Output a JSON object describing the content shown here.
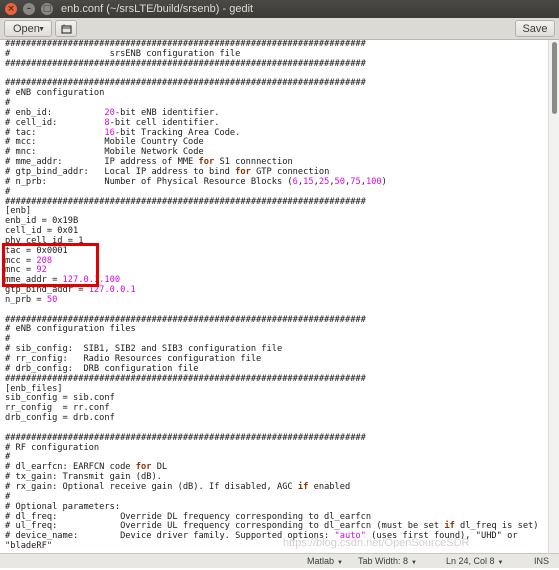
{
  "window": {
    "title": "enb.conf (~/srsLTE/build/srsenb) - gedit",
    "close_glyph": "×",
    "min_glyph": "–",
    "max_glyph": "□"
  },
  "toolbar": {
    "open_label": "Open",
    "open_icon": "chevron-down-icon",
    "new_tab_icon": "new-tab-icon",
    "save_label": "Save"
  },
  "editor": {
    "lines": [
      {
        "segs": [
          {
            "t": "#####################################################################"
          }
        ]
      },
      {
        "segs": [
          {
            "t": "#                   srsENB configuration file"
          }
        ]
      },
      {
        "segs": [
          {
            "t": "#####################################################################"
          }
        ]
      },
      {
        "segs": [
          {
            "t": ""
          }
        ]
      },
      {
        "segs": [
          {
            "t": "#####################################################################"
          }
        ]
      },
      {
        "segs": [
          {
            "t": "# eNB configuration"
          }
        ]
      },
      {
        "segs": [
          {
            "t": "#"
          }
        ]
      },
      {
        "segs": [
          {
            "t": "# enb_id:          "
          },
          {
            "t": "20",
            "c": "n"
          },
          {
            "t": "-bit eNB identifier."
          }
        ]
      },
      {
        "segs": [
          {
            "t": "# cell_id:         "
          },
          {
            "t": "8",
            "c": "n"
          },
          {
            "t": "-bit cell identifier."
          }
        ]
      },
      {
        "segs": [
          {
            "t": "# tac:             "
          },
          {
            "t": "16",
            "c": "n"
          },
          {
            "t": "-bit Tracking Area Code."
          }
        ]
      },
      {
        "segs": [
          {
            "t": "# mcc:             Mobile Country Code"
          }
        ]
      },
      {
        "segs": [
          {
            "t": "# mnc:             Mobile Network Code"
          }
        ]
      },
      {
        "segs": [
          {
            "t": "# mme_addr:        IP address of MME "
          },
          {
            "t": "for",
            "c": "k"
          },
          {
            "t": " S1 connnection"
          }
        ]
      },
      {
        "segs": [
          {
            "t": "# gtp_bind_addr:   Local IP address to bind "
          },
          {
            "t": "for",
            "c": "k"
          },
          {
            "t": " GTP connection"
          }
        ]
      },
      {
        "segs": [
          {
            "t": "# n_prb:           Number of Physical Resource Blocks ("
          },
          {
            "t": "6",
            "c": "n"
          },
          {
            "t": ","
          },
          {
            "t": "15",
            "c": "n"
          },
          {
            "t": ","
          },
          {
            "t": "25",
            "c": "n"
          },
          {
            "t": ","
          },
          {
            "t": "50",
            "c": "n"
          },
          {
            "t": ","
          },
          {
            "t": "75",
            "c": "n"
          },
          {
            "t": ","
          },
          {
            "t": "100",
            "c": "n"
          },
          {
            "t": ")"
          }
        ]
      },
      {
        "segs": [
          {
            "t": "#"
          }
        ]
      },
      {
        "segs": [
          {
            "t": "#####################################################################"
          }
        ]
      },
      {
        "segs": [
          {
            "t": "[enb]"
          }
        ]
      },
      {
        "segs": [
          {
            "t": "enb_id = 0x19B"
          }
        ]
      },
      {
        "segs": [
          {
            "t": "cell_id = 0x01"
          }
        ]
      },
      {
        "segs": [
          {
            "t": "phy_cell_id = 1"
          }
        ]
      },
      {
        "segs": [
          {
            "t": "tac = 0x0001"
          }
        ]
      },
      {
        "segs": [
          {
            "t": "mcc = "
          },
          {
            "t": "208",
            "c": "n"
          }
        ]
      },
      {
        "segs": [
          {
            "t": "mnc = "
          },
          {
            "t": "92",
            "c": "n"
          }
        ]
      },
      {
        "segs": [
          {
            "t": "mme_addr = "
          },
          {
            "t": "127.0.1.100",
            "c": "n"
          }
        ]
      },
      {
        "segs": [
          {
            "t": "gtp_bind_addr = "
          },
          {
            "t": "127.0.0.1",
            "c": "n"
          }
        ]
      },
      {
        "segs": [
          {
            "t": "n_prb = "
          },
          {
            "t": "50",
            "c": "n"
          }
        ]
      },
      {
        "segs": [
          {
            "t": ""
          }
        ]
      },
      {
        "segs": [
          {
            "t": "#####################################################################"
          }
        ]
      },
      {
        "segs": [
          {
            "t": "# eNB configuration files"
          }
        ]
      },
      {
        "segs": [
          {
            "t": "#"
          }
        ]
      },
      {
        "segs": [
          {
            "t": "# sib_config:  SIB1, SIB2 and SIB3 configuration file"
          }
        ]
      },
      {
        "segs": [
          {
            "t": "# rr_config:   Radio Resources configuration file"
          }
        ]
      },
      {
        "segs": [
          {
            "t": "# drb_config:  DRB configuration file"
          }
        ]
      },
      {
        "segs": [
          {
            "t": "#####################################################################"
          }
        ]
      },
      {
        "segs": [
          {
            "t": "[enb_files]"
          }
        ]
      },
      {
        "segs": [
          {
            "t": "sib_config = sib.conf"
          }
        ]
      },
      {
        "segs": [
          {
            "t": "rr_config  = rr.conf"
          }
        ]
      },
      {
        "segs": [
          {
            "t": "drb_config = drb.conf"
          }
        ]
      },
      {
        "segs": [
          {
            "t": ""
          }
        ]
      },
      {
        "segs": [
          {
            "t": "#####################################################################"
          }
        ]
      },
      {
        "segs": [
          {
            "t": "# RF configuration"
          }
        ]
      },
      {
        "segs": [
          {
            "t": "#"
          }
        ]
      },
      {
        "segs": [
          {
            "t": "# dl_earfcn: EARFCN code "
          },
          {
            "t": "for",
            "c": "k"
          },
          {
            "t": " DL"
          }
        ]
      },
      {
        "segs": [
          {
            "t": "# tx_gain: Transmit gain (dB)."
          }
        ]
      },
      {
        "segs": [
          {
            "t": "# rx_gain: Optional receive gain (dB). If disabled, AGC "
          },
          {
            "t": "if",
            "c": "k"
          },
          {
            "t": " enabled"
          }
        ]
      },
      {
        "segs": [
          {
            "t": "#"
          }
        ]
      },
      {
        "segs": [
          {
            "t": "# Optional parameters:"
          }
        ]
      },
      {
        "segs": [
          {
            "t": "# dl_freq:            Override DL frequency corresponding to dl_earfcn"
          }
        ]
      },
      {
        "segs": [
          {
            "t": "# ul_freq:            Override UL frequency corresponding to dl_earfcn (must be set "
          },
          {
            "t": "if",
            "c": "k"
          },
          {
            "t": " dl_freq is set)"
          }
        ]
      },
      {
        "segs": [
          {
            "t": "# device_name:        Device driver family. Supported options: "
          },
          {
            "t": "\"auto\"",
            "c": "s"
          },
          {
            "t": " (uses first found), \"UHD\" or"
          }
        ]
      },
      {
        "segs": [
          {
            "t": "\"bladeRF\""
          }
        ]
      }
    ]
  },
  "statusbar": {
    "language": "Matlab",
    "tab_width": "Tab Width: 8",
    "position": "Ln 24, Col 8",
    "mode": "INS"
  },
  "watermark": "https://blog.csdn.net/OpenSourceSDR"
}
